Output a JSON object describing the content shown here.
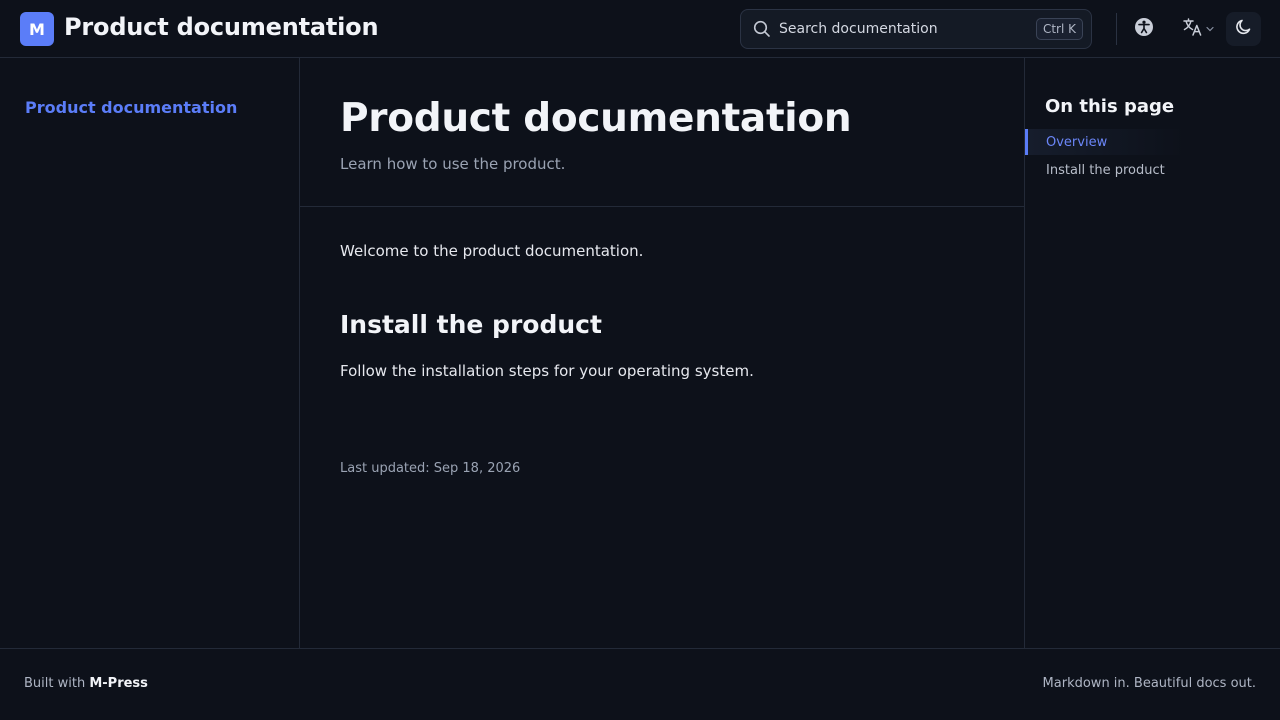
{
  "header": {
    "logo_letter": "M",
    "site_title": "Product documentation",
    "search": {
      "placeholder": "Search documentation",
      "shortcut": "Ctrl K"
    },
    "icons": [
      "search-icon",
      "accessibility-icon",
      "translate-icon",
      "chevron-down-icon",
      "moon-icon"
    ]
  },
  "sidebar": {
    "items": [
      {
        "label": "Product documentation",
        "active": true
      }
    ]
  },
  "main": {
    "title": "Product documentation",
    "subtitle": "Learn how to use the product.",
    "intro": "Welcome to the product documentation.",
    "sections": [
      {
        "heading": "Install the product",
        "text": "Follow the installation steps for your operating system."
      }
    ],
    "last_updated": "Last updated: Sep 18, 2026"
  },
  "toc": {
    "title": "On this page",
    "items": [
      {
        "label": "Overview",
        "active": true
      },
      {
        "label": "Install the product",
        "active": false
      }
    ]
  },
  "footer": {
    "built_with_prefix": "Built with",
    "built_with_name": "M-Press",
    "tagline": "Markdown in. Beautiful docs out."
  },
  "colors": {
    "background": "#0d111a",
    "accent": "#5b7df8",
    "border": "#232a38",
    "muted_text": "#9aa3b3"
  }
}
